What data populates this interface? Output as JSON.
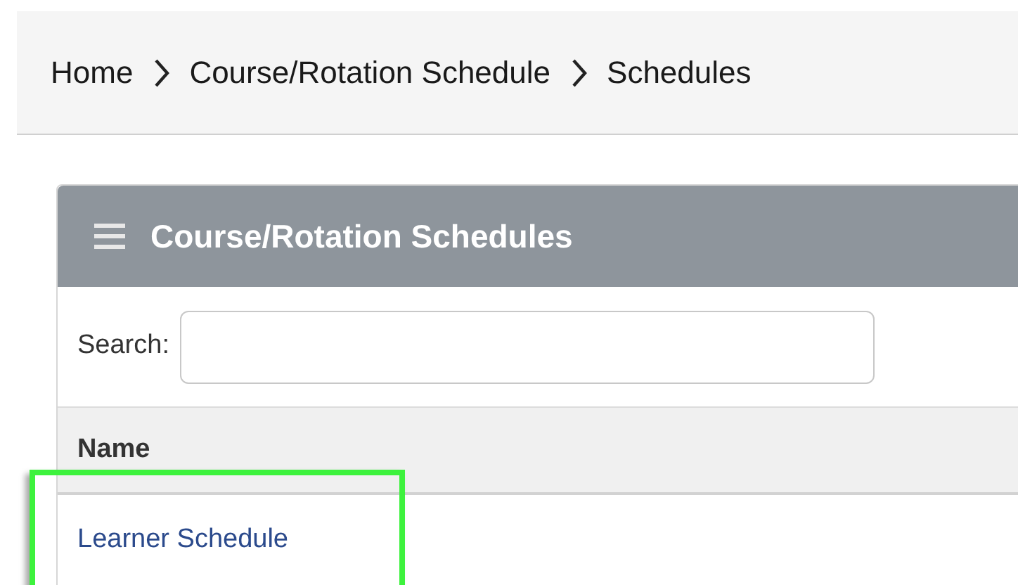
{
  "breadcrumb": [
    {
      "label": "Home"
    },
    {
      "label": "Course/Rotation Schedule"
    },
    {
      "label": "Schedules"
    }
  ],
  "panel": {
    "title": "Course/Rotation Schedules",
    "search": {
      "label": "Search:"
    },
    "table": {
      "columns": [
        "Name"
      ],
      "rows": [
        {
          "name": "Learner Schedule",
          "highlighted": true
        }
      ]
    }
  }
}
